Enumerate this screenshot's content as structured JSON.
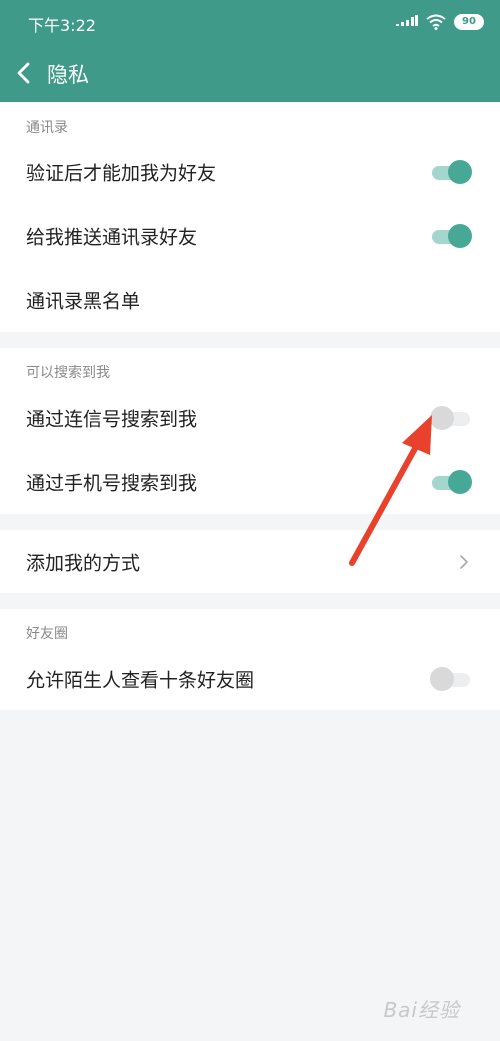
{
  "status_bar": {
    "time": "下午3:22",
    "battery": "90"
  },
  "nav": {
    "title": "隐私"
  },
  "sections": [
    {
      "header": "通讯录",
      "rows": [
        {
          "label": "验证后才能加我为好友",
          "toggle": "on"
        },
        {
          "label": "给我推送通讯录好友",
          "toggle": "on"
        },
        {
          "label": "通讯录黑名单"
        }
      ]
    },
    {
      "header": "可以搜索到我",
      "rows": [
        {
          "label": "通过连信号搜索到我",
          "toggle": "off"
        },
        {
          "label": "通过手机号搜索到我",
          "toggle": "on"
        }
      ]
    },
    {
      "rows": [
        {
          "label": "添加我的方式"
        }
      ]
    },
    {
      "header": "好友圈",
      "rows": [
        {
          "label": "允许陌生人查看十条好友圈",
          "toggle": "off"
        }
      ]
    }
  ],
  "watermark": "Bai经验",
  "colors": {
    "header": "#3f9a89",
    "toggle_on": "#47a896",
    "arrow": "#e8412c"
  }
}
